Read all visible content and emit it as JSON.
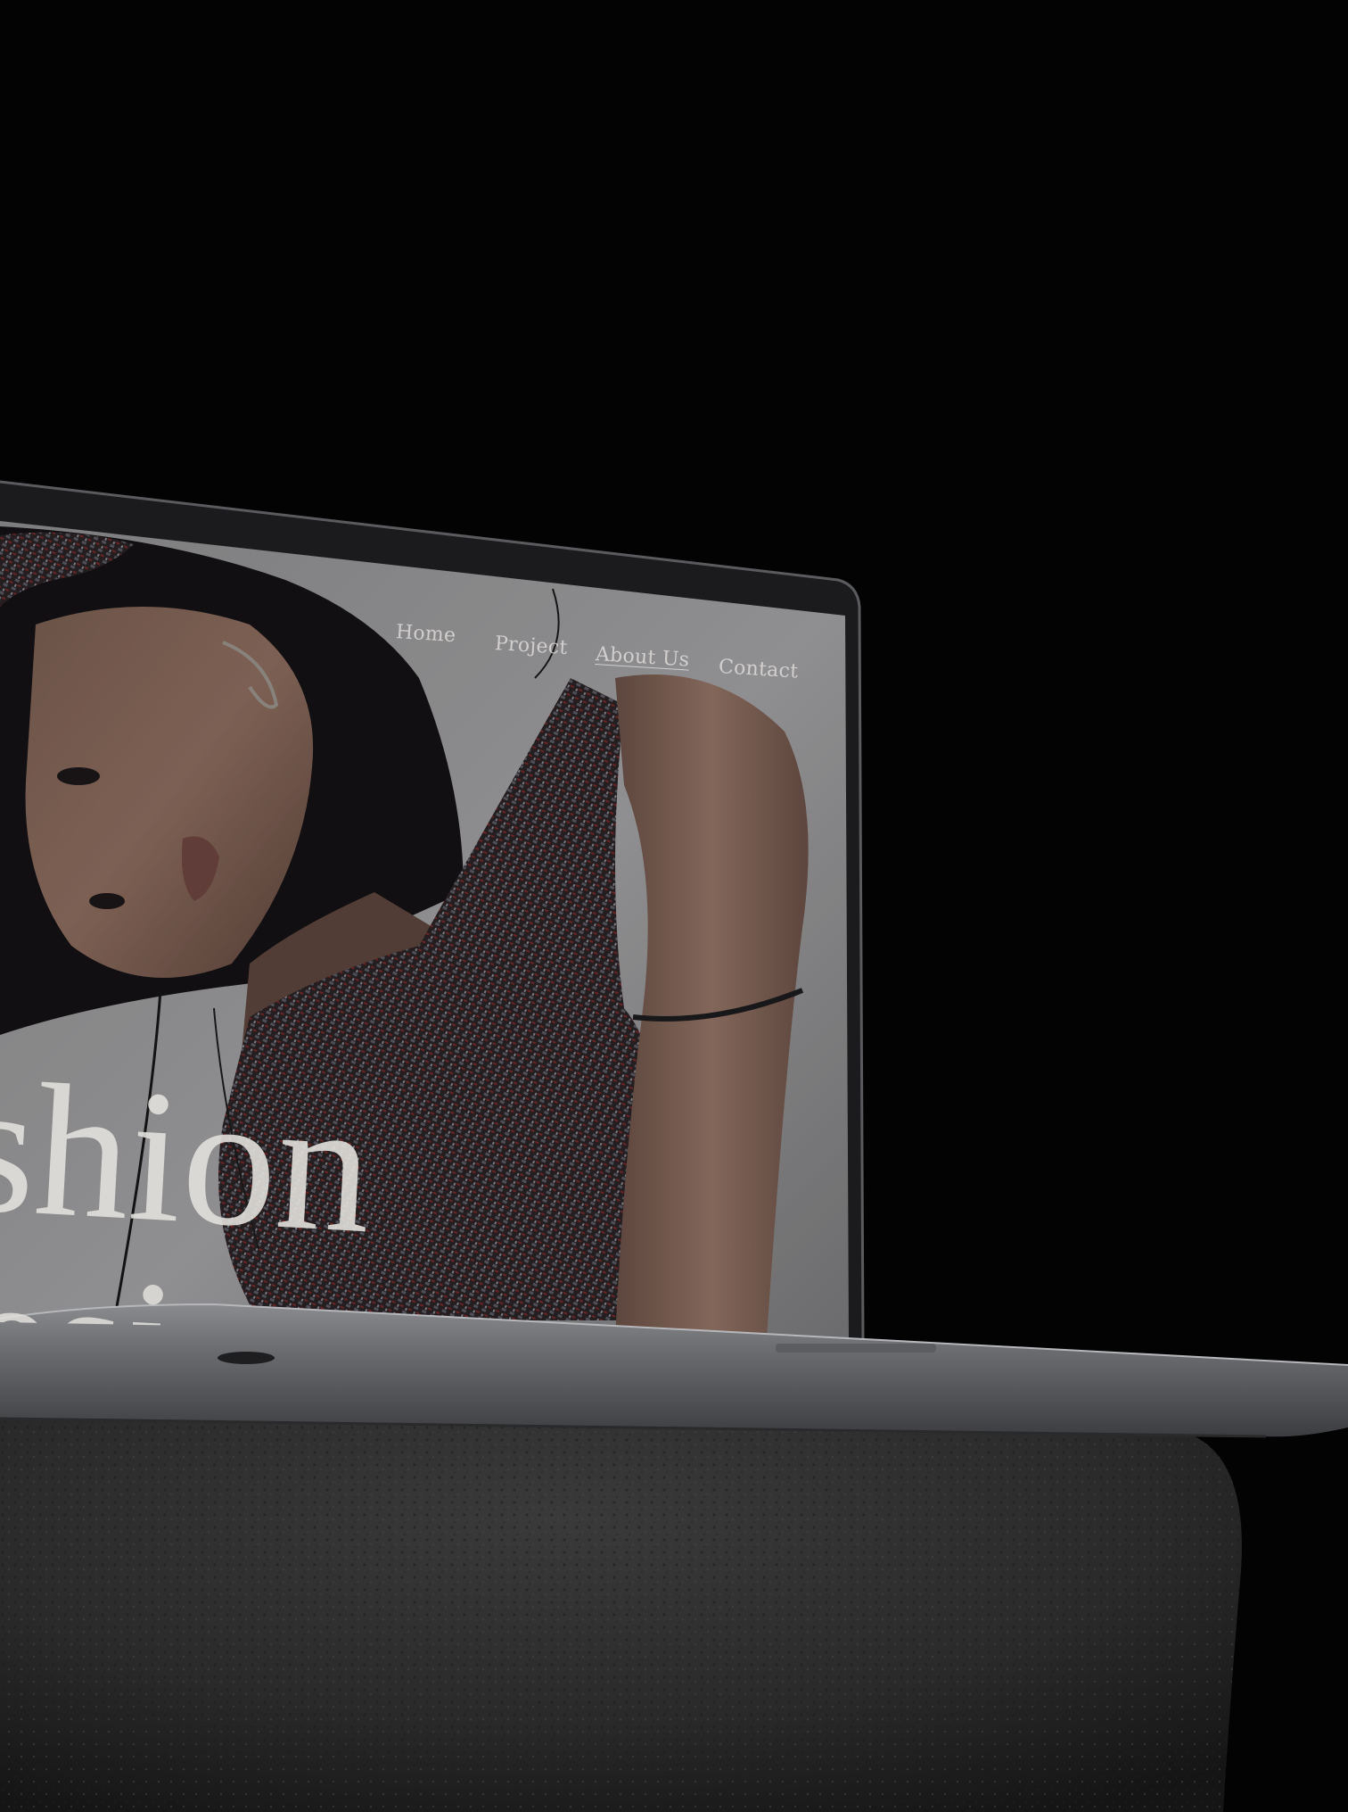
{
  "screen": {
    "nav": {
      "home": "Home",
      "project": "Project",
      "about": "About Us",
      "contact": "Contact"
    },
    "hero_title": "shion",
    "hero_subtitle_fragment": "esi"
  },
  "colors": {
    "background": "#030303",
    "screen_backdrop": "#9a9a9c",
    "laptop_body": "#6f7073",
    "rock": "#2b2b2b"
  }
}
